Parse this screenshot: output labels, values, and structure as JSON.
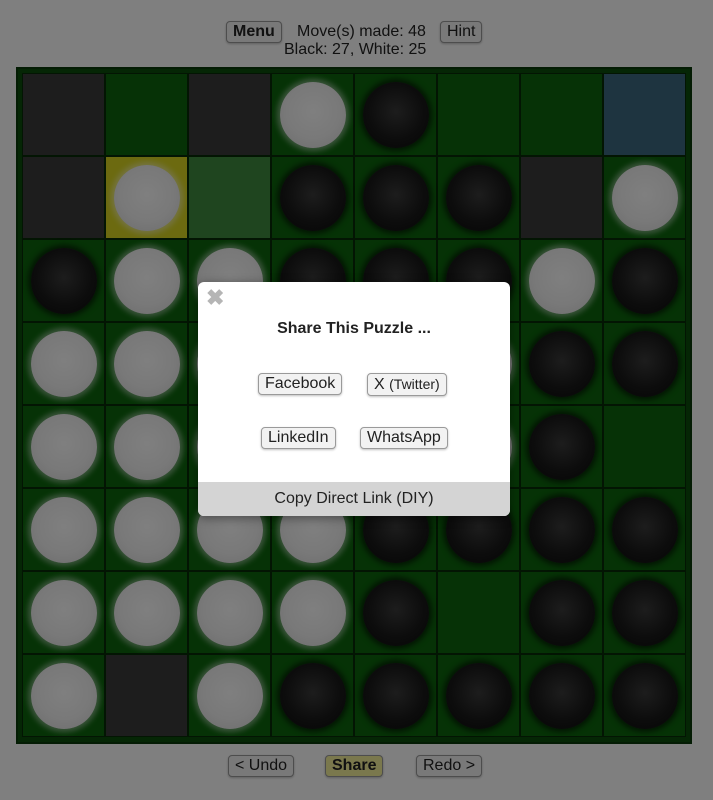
{
  "header": {
    "menu_label": "Menu",
    "moves_text": "Move(s) made: 48",
    "hint_label": "Hint",
    "score_text": "Black: 27, White: 25"
  },
  "board": {
    "rows": 8,
    "cols": 8,
    "discs": [
      [
        "",
        "",
        "",
        "w",
        "b",
        "",
        "",
        ""
      ],
      [
        "",
        "w",
        "",
        "b",
        "b",
        "b",
        "",
        "w"
      ],
      [
        "b",
        "w",
        "w",
        "b",
        "b",
        "b",
        "w",
        "b"
      ],
      [
        "w",
        "w",
        "w",
        "w",
        "w",
        "w",
        "b",
        "b"
      ],
      [
        "w",
        "w",
        "w",
        "w",
        "w",
        "w",
        "b",
        ""
      ],
      [
        "w",
        "w",
        "w",
        "w",
        "b",
        "b",
        "b",
        "b"
      ],
      [
        "w",
        "w",
        "w",
        "w",
        "b",
        "",
        "b",
        "b"
      ],
      [
        "w",
        "",
        "w",
        "b",
        "b",
        "b",
        "b",
        "b"
      ]
    ],
    "cell_styles": [
      [
        "gray",
        "",
        "gray",
        "",
        "",
        "",
        "",
        "blue"
      ],
      [
        "gray",
        "yellow",
        "lightgreen",
        "",
        "",
        "",
        "gray",
        ""
      ],
      [
        "",
        "",
        "",
        "",
        "",
        "",
        "",
        ""
      ],
      [
        "",
        "",
        "",
        "",
        "",
        "",
        "",
        ""
      ],
      [
        "",
        "",
        "",
        "",
        "",
        "",
        "",
        ""
      ],
      [
        "",
        "",
        "",
        "",
        "",
        "",
        "",
        ""
      ],
      [
        "",
        "",
        "",
        "",
        "",
        "",
        "",
        ""
      ],
      [
        "",
        "gray",
        "",
        "",
        "",
        "",
        "",
        ""
      ]
    ],
    "colors": {
      "board_green": "#0c650c",
      "unavailable_gray": "#3a3a3a",
      "blue_cell": "#3d6880",
      "last_move_yellow": "#d8d520",
      "highlight_green": "#3f8a3f"
    }
  },
  "footer": {
    "undo_label": "< Undo",
    "share_label": "Share",
    "redo_label": "Redo >"
  },
  "share_dialog": {
    "close_icon": "close-icon",
    "title": "Share This Puzzle ...",
    "facebook_label": "Facebook",
    "x_label": "X",
    "x_sub_label": "(Twitter)",
    "linkedin_label": "LinkedIn",
    "whatsapp_label": "WhatsApp",
    "copy_link_label": "Copy Direct Link (DIY)"
  }
}
